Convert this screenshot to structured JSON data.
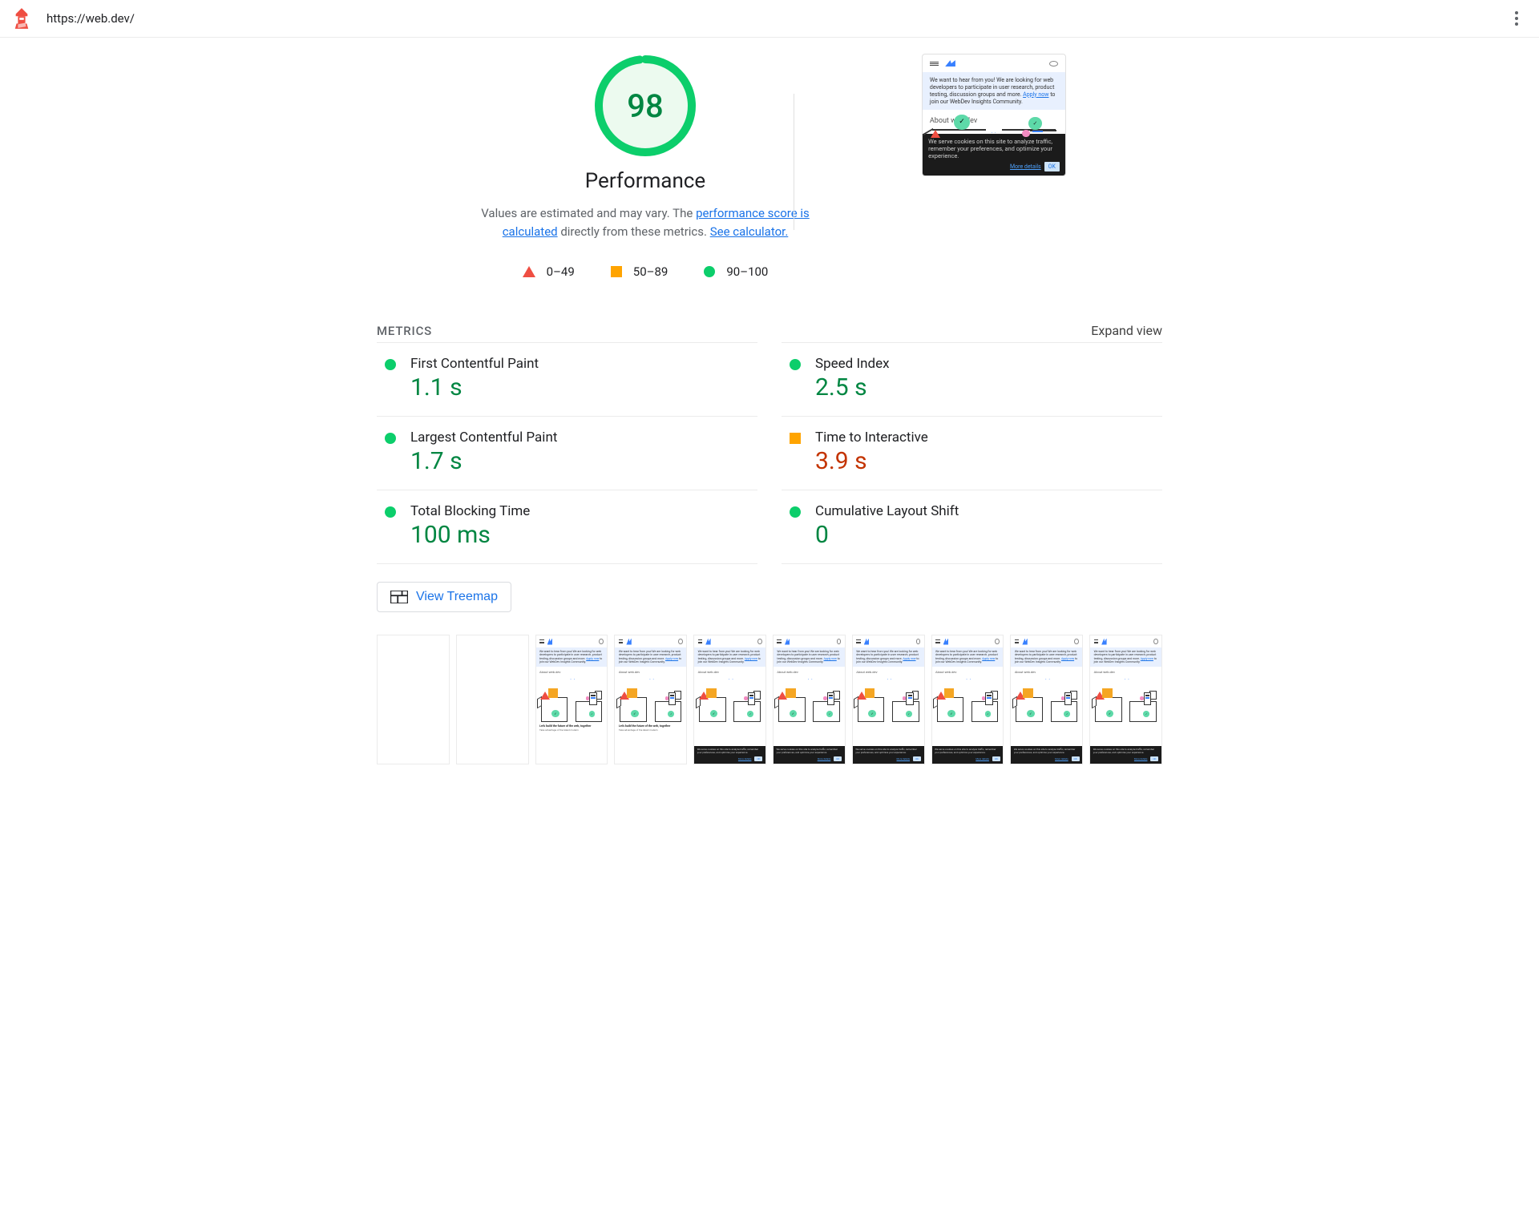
{
  "url": "https://web.dev/",
  "gauge": {
    "score": "98",
    "label": "Performance"
  },
  "disclaimer": {
    "prefix": "Values are estimated and may vary. The ",
    "link1": "performance score is calculated",
    "middle": " directly from these metrics. ",
    "link2": "See calculator."
  },
  "legend": {
    "fail": "0–49",
    "avg": "50–89",
    "pass": "90–100"
  },
  "metricsHeader": {
    "title": "METRICS",
    "expand": "Expand view"
  },
  "metrics": [
    {
      "label": "First Contentful Paint",
      "value": "1.1 s",
      "status": "pass"
    },
    {
      "label": "Speed Index",
      "value": "2.5 s",
      "status": "pass"
    },
    {
      "label": "Largest Contentful Paint",
      "value": "1.7 s",
      "status": "pass"
    },
    {
      "label": "Time to Interactive",
      "value": "3.9 s",
      "status": "avg"
    },
    {
      "label": "Total Blocking Time",
      "value": "100 ms",
      "status": "pass"
    },
    {
      "label": "Cumulative Layout Shift",
      "value": "0",
      "status": "pass"
    }
  ],
  "treemap": "View Treemap",
  "preview": {
    "banner": "We want to hear from you! We are looking for web developers to participate in user research, product testing, discussion groups and more. ",
    "bannerLink": "Apply now",
    "bannerSuffix": " to join our WebDev Insights Community.",
    "about": "About web.dev",
    "cookie": "We serve cookies on this site to analyze traffic, remember your preferences, and optimize your experience.",
    "moreDetails": "More details",
    "ok": "OK",
    "tagline": "Let's build the future of the web, together",
    "sub": "Take advantage of the latest modern"
  },
  "filmstrip": [
    "blank",
    "blank",
    "partial",
    "partial",
    "cookie",
    "cookie",
    "cookie",
    "cookie",
    "cookie",
    "cookie"
  ]
}
